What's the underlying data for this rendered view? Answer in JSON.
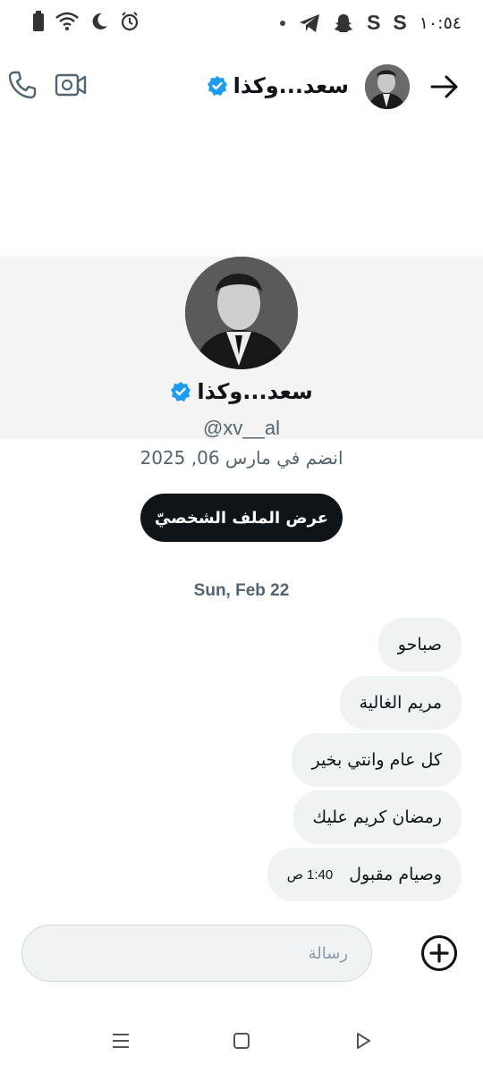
{
  "status_bar": {
    "time": "١٠:٥٤",
    "left_icons": [
      "battery-icon",
      "wifi-icon",
      "moon-icon",
      "alarm-icon"
    ],
    "right_icons": [
      "dot-icon",
      "telegram-icon",
      "snapchat-icon",
      "s-app-icon",
      "s-app-icon"
    ],
    "s_letter": "S"
  },
  "header": {
    "name": "سعد...وكذا",
    "verified": true,
    "icons": [
      "back-arrow-icon",
      "phone-icon",
      "video-call-icon"
    ]
  },
  "profile": {
    "name": "سعد...وكذا",
    "handle": "@xv__al",
    "joined": "انضم في مارس 06, 2025",
    "view_profile_label": "عرض الملف الشخصيّ"
  },
  "conversation": {
    "date_separator": "Sun, Feb 22",
    "messages": [
      {
        "text": "صباحو",
        "time": ""
      },
      {
        "text": "مريم الغالية",
        "time": ""
      },
      {
        "text": "كل عام وانتي بخير",
        "time": ""
      },
      {
        "text": "رمضان كريم عليك",
        "time": ""
      },
      {
        "text": "وصيام مقبول",
        "time": "1:40 ص"
      }
    ]
  },
  "composer": {
    "placeholder": "رسالة",
    "value": ""
  },
  "nav_bar": {
    "icons": [
      "recents-icon",
      "home-icon",
      "back-icon"
    ]
  },
  "colors": {
    "verified_blue": "#1d9bf0",
    "button_bg": "#0f1419",
    "bubble_bg": "#eff3f4",
    "secondary_text": "#536471"
  }
}
